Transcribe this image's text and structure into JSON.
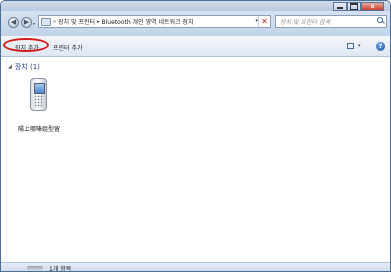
{
  "window": {
    "minimize_icon": "minimize-icon",
    "maximize_icon": "maximize-icon",
    "close_icon": "close-icon",
    "close_glyph": "x"
  },
  "navigation": {
    "back_glyph": "◀",
    "forward_glyph": "▶",
    "history_glyph": "▾"
  },
  "address": {
    "prefix": "«",
    "crumbs": [
      "장치 및 프린터",
      "Bluetooth 개인 영역 네트워크 장치"
    ],
    "separator": "▸",
    "dropdown_glyph": "▾",
    "refresh_glyph": "✕"
  },
  "search": {
    "placeholder": "장치 및 프린터 검색"
  },
  "commands": {
    "add_device": "장치 추가",
    "add_printer": "프린터 추가",
    "view_dropdown_glyph": "▾",
    "help_glyph": "?"
  },
  "content": {
    "group_toggle": "◢",
    "group_title": "장치 (1)",
    "devices": [
      {
        "label": "陽上哪嗪姐型留",
        "icon": "mobile-phone-icon"
      }
    ]
  },
  "details": {
    "text": "1개 항목"
  },
  "colors": {
    "highlight_ring": "#d01e1e",
    "group_title": "#1c3e8c",
    "refresh": "#d02424"
  }
}
